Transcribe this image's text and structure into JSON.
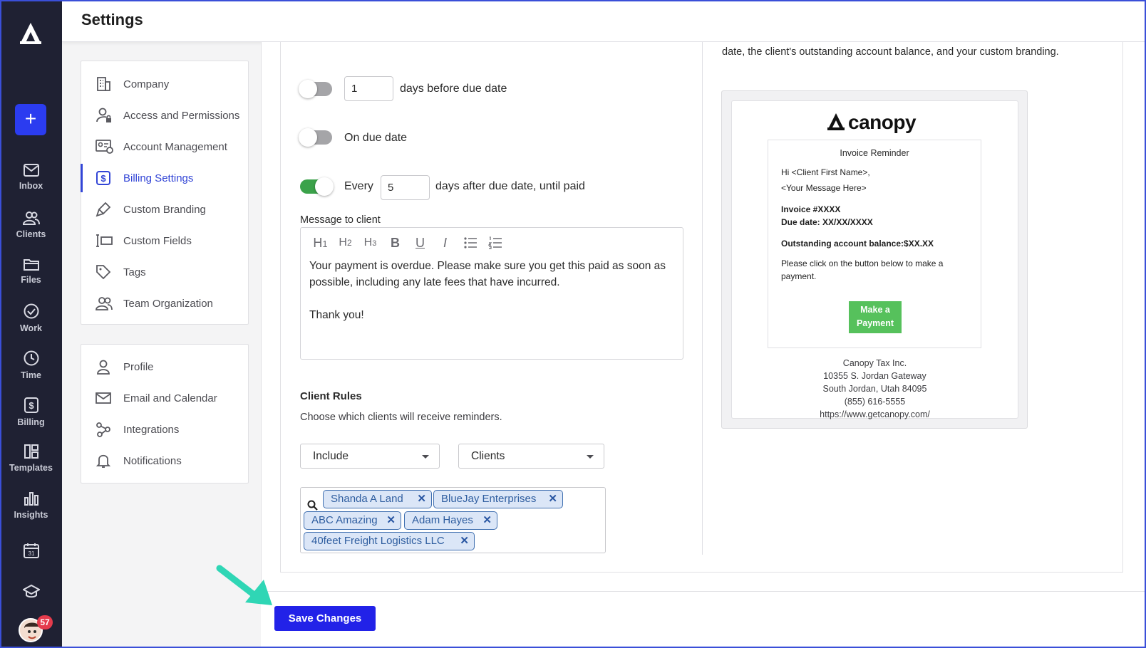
{
  "header": {
    "title": "Settings"
  },
  "rail": {
    "items": [
      {
        "label": "Inbox",
        "icon": "mail-icon"
      },
      {
        "label": "Clients",
        "icon": "clients-icon"
      },
      {
        "label": "Files",
        "icon": "folder-icon"
      },
      {
        "label": "Work",
        "icon": "check-circle-icon"
      },
      {
        "label": "Time",
        "icon": "clock-icon"
      },
      {
        "label": "Billing",
        "icon": "billing-icon"
      },
      {
        "label": "Templates",
        "icon": "templates-icon"
      },
      {
        "label": "Insights",
        "icon": "bar-chart-icon"
      }
    ],
    "notification_count": "57",
    "accent": "#2b3cf0"
  },
  "nav": {
    "group1": [
      {
        "label": "Company",
        "icon": "building-icon"
      },
      {
        "label": "Access and Permissions",
        "icon": "user-lock-icon"
      },
      {
        "label": "Account Management",
        "icon": "id-card-gear-icon"
      },
      {
        "label": "Billing Settings",
        "icon": "dollar-square-icon",
        "active": true
      },
      {
        "label": "Custom Branding",
        "icon": "brush-icon"
      },
      {
        "label": "Custom Fields",
        "icon": "text-field-icon"
      },
      {
        "label": "Tags",
        "icon": "tag-icon"
      },
      {
        "label": "Team Organization",
        "icon": "team-icon"
      }
    ],
    "group2": [
      {
        "label": "Profile",
        "icon": "user-icon"
      },
      {
        "label": "Email and Calendar",
        "icon": "envelope-icon"
      },
      {
        "label": "Integrations",
        "icon": "share-nodes-icon"
      },
      {
        "label": "Notifications",
        "icon": "bell-icon"
      }
    ],
    "active_color": "#3245d6"
  },
  "reminders": {
    "before": {
      "enabled": false,
      "days": "1",
      "label": "days before due date"
    },
    "on_due": {
      "enabled": false,
      "label": "On due date"
    },
    "after": {
      "enabled": true,
      "prefix": "Every",
      "days": "5",
      "label": "days after due date, until paid"
    },
    "toggle_on_color": "#3ba24a"
  },
  "message": {
    "label": "Message to client",
    "toolbar": [
      "H1",
      "H2",
      "H3",
      "B",
      "U",
      "I",
      "bullet-list",
      "numbered-list"
    ],
    "body_line1": "Your payment is overdue. Please make sure you get this paid as soon as possible, including any late fees that have incurred.",
    "body_line2": "Thank you!"
  },
  "client_rules": {
    "title": "Client Rules",
    "subtitle": "Choose which clients will receive reminders.",
    "mode": "Include",
    "target": "Clients",
    "tags": [
      "Shanda A Land",
      "BlueJay Enterprises",
      "ABC Amazing",
      "Adam Hayes",
      "40feet Freight Logistics LLC"
    ]
  },
  "preview": {
    "intro": "date, the client's outstanding account balance, and your custom branding.",
    "brand": "canopy",
    "email_title": "Invoice Reminder",
    "greeting": "Hi <Client First Name>,",
    "message_placeholder": "<Your Message Here>",
    "invoice": "Invoice #XXXX",
    "due_date": "Due date: XX/XX/XXXX",
    "balance": "Outstanding account balance:$XX.XX",
    "instruction": "Please click on the button below to make a payment.",
    "button": "Make a Payment",
    "company": "Canopy Tax Inc.",
    "street": "10355 S. Jordan Gateway",
    "city": "South Jordan, Utah 84095",
    "phone": "(855) 616-5555",
    "url": "https://www.getcanopy.com/",
    "button_color": "#56c15c"
  },
  "footer": {
    "save_label": "Save Changes",
    "save_color": "#2222e8"
  }
}
